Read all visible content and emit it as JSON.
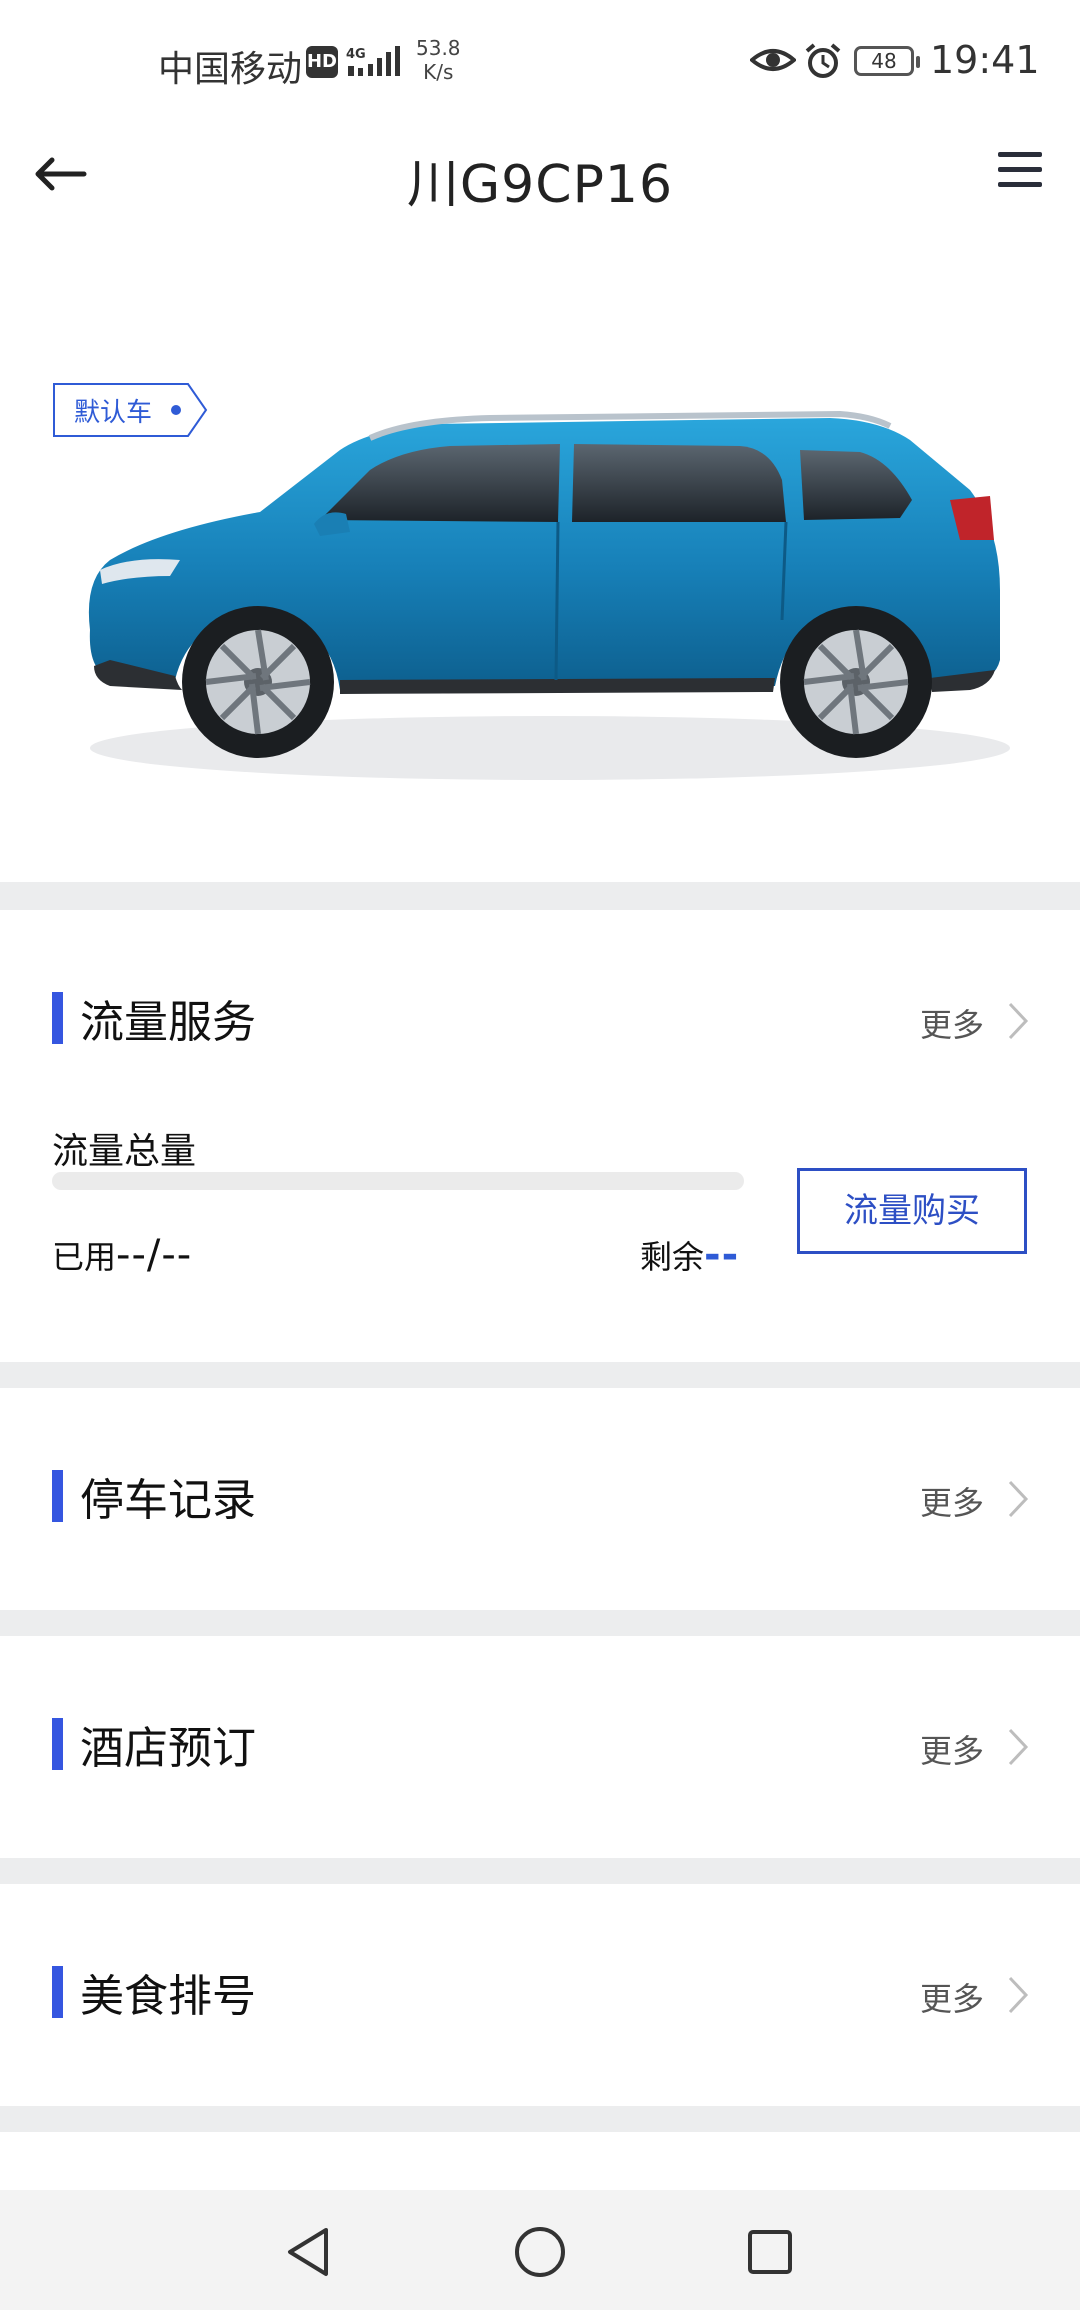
{
  "status_bar": {
    "carrier": "中国移动",
    "hd_badge": "HD",
    "network": "4G",
    "speed_value": "53.8",
    "speed_unit": "K/s",
    "battery": "48",
    "time": "19:41"
  },
  "header": {
    "title": "川G9CP16",
    "back_icon": "arrow-left-icon",
    "menu_icon": "hamburger-menu-icon"
  },
  "hero": {
    "default_tag": "默认车",
    "car_color": "#1f8ec6"
  },
  "sections": {
    "data_service": {
      "title": "流量服务",
      "more": "更多",
      "total_label": "流量总量",
      "used_label": "已用",
      "used_value": "--/--",
      "remain_label": "剩余",
      "remain_value": "--",
      "buy_button": "流量购买",
      "progress_fraction": 0
    },
    "parking": {
      "title": "停车记录",
      "more": "更多"
    },
    "hotel": {
      "title": "酒店预订",
      "more": "更多"
    },
    "food": {
      "title": "美食排号",
      "more": "更多"
    }
  },
  "colors": {
    "accent": "#3556e0",
    "divider": "#ecedee"
  },
  "system_nav": {
    "back": "triangle-back-icon",
    "home": "circle-home-icon",
    "recents": "square-recents-icon"
  }
}
